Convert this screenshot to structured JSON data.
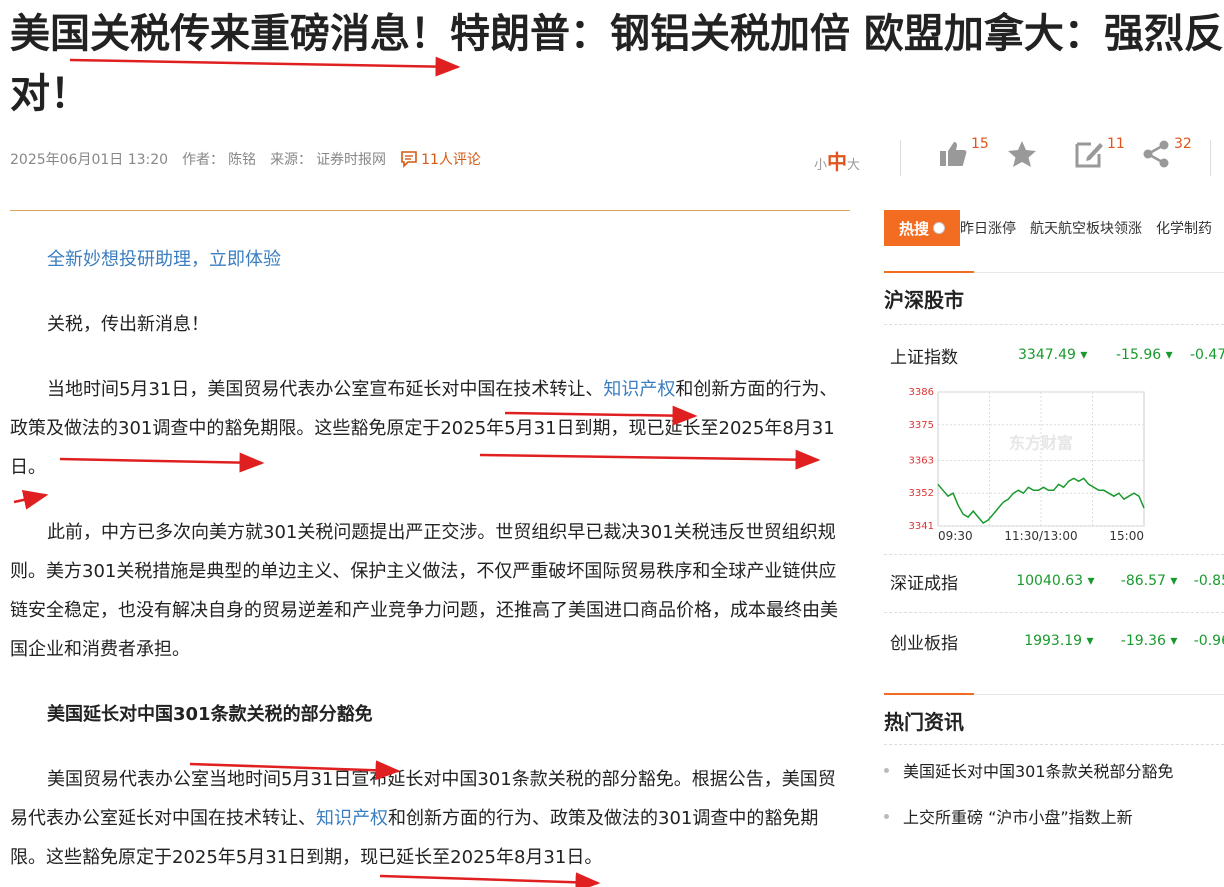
{
  "headline": {
    "line1": "美国关税传来重磅消息！特朗普：钢铝关税加倍 欧盟加拿大：强烈反",
    "line2": "对！"
  },
  "meta": {
    "datetime": "2025年06月01日 13:20",
    "author_label": "作者：",
    "author": "陈铭",
    "source_label": "来源：",
    "source": "证券时报网",
    "comments": "11人评论"
  },
  "font_size": {
    "small": "小",
    "medium": "中",
    "large": "大"
  },
  "actions": {
    "like_count": "15",
    "edit_count": "11",
    "share_count": "32"
  },
  "article": {
    "promo": "全新妙想投研助理，立即体验",
    "p1": "关税，传出新消息！",
    "p2a": "当地时间5月31日，美国贸易代表办公室宣布延长对中国在技术转让、",
    "p2_link": "知识产权",
    "p2b": "和创新方面的行为、政策及做法的301调查中的豁免期限。这些豁免原定于2025年5月31日到期，现已延长至2025年8月31日。",
    "p3": "此前，中方已多次向美方就301关税问题提出严正交涉。世贸组织早已裁决301关税违反世贸组织规则。美方301关税措施是典型的单边主义、保护主义做法，不仅严重破坏国际贸易秩序和全球产业链供应链安全稳定，也没有解决自身的贸易逆差和产业竞争力问题，还推高了美国进口商品价格，成本最终由美国企业和消费者承担。",
    "subhead": "美国延长对中国301条款关税的部分豁免",
    "p4a": "美国贸易代表办公室当地时间5月31日宣布延长对中国301条款关税的部分豁免。根据公告，美国贸易代表办公室延长对中国在技术转让、",
    "p4_link": "知识产权",
    "p4b": "和创新方面的行为、政策及做法的301调查中的豁免期限。这些豁免原定于2025年5月31日到期，现已延长至2025年8月31日。"
  },
  "sidebar": {
    "hot_search_label": "热搜",
    "hot_keywords": [
      "昨日涨停",
      "航天航空板块领涨",
      "化学制药"
    ],
    "market_title": "沪深股市",
    "indices": [
      {
        "name": "上证指数",
        "value": "3347.49",
        "change": "-15.96",
        "pct": "-0.47"
      },
      {
        "name": "深证成指",
        "value": "10040.63",
        "change": "-86.57",
        "pct": "-0.85"
      },
      {
        "name": "创业板指",
        "value": "1993.19",
        "change": "-19.36",
        "pct": "-0.96"
      }
    ],
    "news_title": "热门资讯",
    "news": [
      "美国延长对中国301条款关税部分豁免",
      "上交所重磅 “沪市小盘”指数上新"
    ]
  },
  "chart_data": {
    "type": "line",
    "title": "",
    "watermark": "东方财富",
    "x_ticks": [
      "09:30",
      "11:30/13:00",
      "15:00"
    ],
    "y_ticks": [
      3386,
      3375,
      3363,
      3352,
      3341
    ],
    "ylim": [
      3341,
      3386
    ],
    "grid": true,
    "series": [
      {
        "values": [
          3355,
          3353,
          3351,
          3352,
          3348,
          3345,
          3344,
          3346,
          3344,
          3342,
          3343,
          3345,
          3347,
          3349,
          3350,
          3352,
          3353,
          3352,
          3354,
          3353,
          3353,
          3354,
          3353,
          3353,
          3355,
          3354,
          3356,
          3357,
          3356,
          3357,
          3355,
          3354,
          3353,
          3353,
          3352,
          3351,
          3352,
          3350,
          3351,
          3352,
          3351,
          3347
        ]
      }
    ]
  }
}
